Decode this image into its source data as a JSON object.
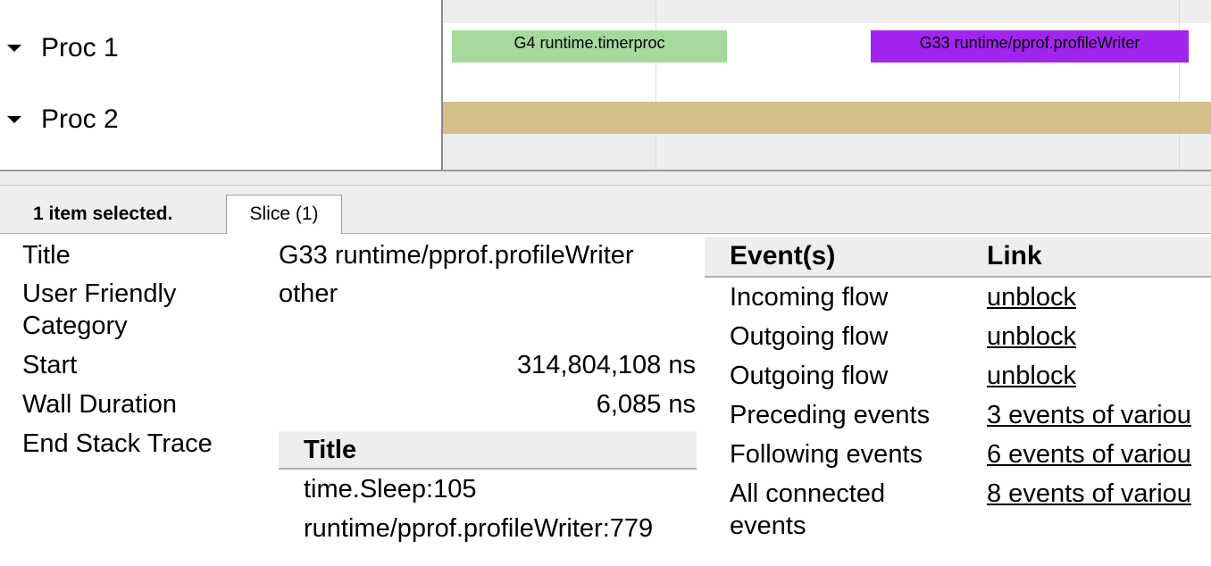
{
  "procs": [
    {
      "label": "Proc 1"
    },
    {
      "label": "Proc 2"
    }
  ],
  "slices": {
    "timerproc": {
      "label": "G4 runtime.timerproc",
      "color": "#a6d99c"
    },
    "profile_writer": {
      "label": "G33 runtime/pprof.profileWriter",
      "color": "#a224f0"
    },
    "proc2_bar": {
      "label": "",
      "color": "#d4c08a"
    }
  },
  "panel": {
    "selected_count": "1 item selected.",
    "tab_label": "Slice (1)"
  },
  "details": {
    "title_label": "Title",
    "title_value": "G33 runtime/pprof.profileWriter",
    "category_label_1": "User Friendly",
    "category_label_2": "Category",
    "category_value": "other",
    "start_label": "Start",
    "start_value": "314,804,108 ns",
    "duration_label": "Wall Duration",
    "duration_value": "6,085 ns",
    "stack_label": "End Stack Trace"
  },
  "stack_trace": {
    "header": "Title",
    "rows": [
      "time.Sleep:105",
      "runtime/pprof.profileWriter:779"
    ]
  },
  "flows": {
    "header_events": "Event(s)",
    "header_link": "Link",
    "rows": [
      {
        "event": "Incoming flow",
        "link": "unblock"
      },
      {
        "event": "Outgoing flow",
        "link": "unblock"
      },
      {
        "event": "Outgoing flow",
        "link": "unblock"
      },
      {
        "event": "Preceding events",
        "link": "3 events of variou"
      },
      {
        "event": "Following events",
        "link": "6 events of variou"
      },
      {
        "event": "All connected",
        "event_line2": "events",
        "link": "8 events of variou"
      }
    ]
  }
}
